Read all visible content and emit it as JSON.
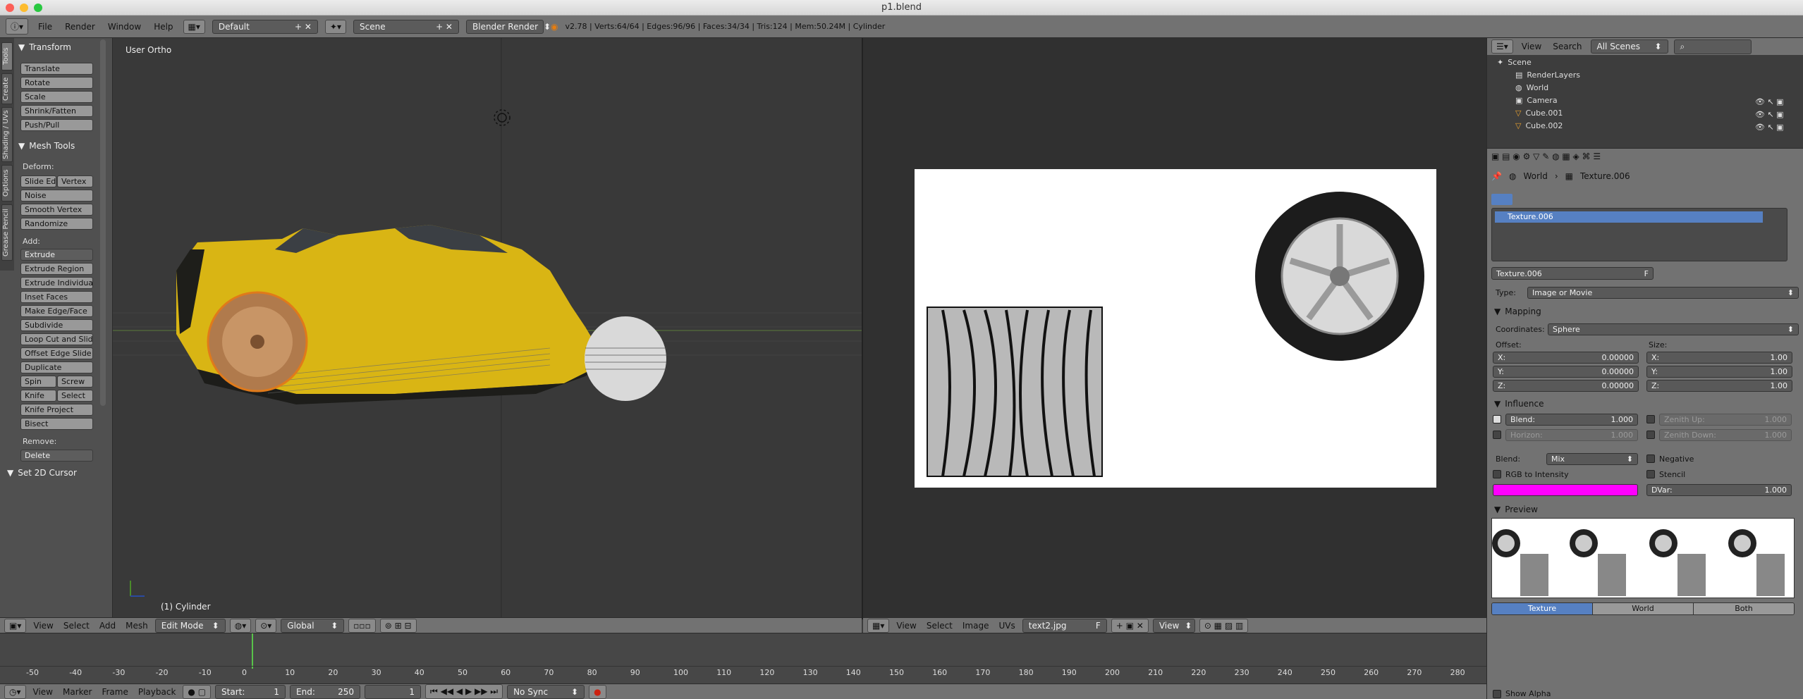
{
  "window": {
    "title": "p1.blend"
  },
  "infobar": {
    "menus": [
      "File",
      "Render",
      "Window",
      "Help"
    ],
    "layout": "Default",
    "scene": "Scene",
    "engine": "Blender Render",
    "stats": "v2.78 | Verts:64/64 | Edges:96/96 | Faces:34/34 | Tris:124 | Mem:50.24M | Cylinder"
  },
  "toolshelf": {
    "tabs": [
      "Tools",
      "Create",
      "Shading / UVs",
      "Options",
      "Grease Pencil"
    ],
    "transform_title": "Transform",
    "transform": [
      "Translate",
      "Rotate",
      "Scale",
      "Shrink/Fatten",
      "Push/Pull"
    ],
    "mesh_title": "Mesh Tools",
    "deform_label": "Deform:",
    "slide_edge": "Slide Ed",
    "vertex": "Vertex",
    "noise": "Noise",
    "smooth_vertex": "Smooth Vertex",
    "randomize": "Randomize",
    "add_label": "Add:",
    "extrude": "Extrude",
    "add_items": [
      "Extrude Region",
      "Extrude Individual",
      "Inset Faces",
      "Make Edge/Face",
      "Subdivide",
      "Loop Cut and Slide",
      "Offset Edge Slide",
      "Duplicate"
    ],
    "spin": "Spin",
    "screw": "Screw",
    "knife": "Knife",
    "select": "Select",
    "knife_project": "Knife Project",
    "bisect": "Bisect",
    "remove_label": "Remove:",
    "delete": "Delete",
    "cursor_title": "Set 2D Cursor"
  },
  "viewport": {
    "view_name": "User Ortho",
    "object_name": "(1) Cylinder"
  },
  "header3d": {
    "menus": [
      "View",
      "Select",
      "Add",
      "Mesh"
    ],
    "mode": "Edit Mode",
    "orientation": "Global"
  },
  "imgheader": {
    "menus": [
      "View",
      "Select",
      "Image",
      "UVs"
    ],
    "image": "text2.jpg",
    "view": "View",
    "f": "F"
  },
  "timeline": {
    "ticks": [
      "-50",
      "-40",
      "-30",
      "-20",
      "-10",
      "0",
      "10",
      "20",
      "30",
      "40",
      "50",
      "60",
      "70",
      "80",
      "90",
      "100",
      "110",
      "120",
      "130",
      "140",
      "150",
      "160",
      "170",
      "180",
      "190",
      "200",
      "210",
      "220",
      "230",
      "240",
      "250",
      "260",
      "270",
      "280"
    ],
    "current_frame": 1,
    "header_menus": [
      "View",
      "Marker",
      "Frame",
      "Playback"
    ],
    "start_label": "Start:",
    "start": "1",
    "end_label": "End:",
    "end": "250",
    "frame": "1",
    "sync": "No Sync"
  },
  "outliner": {
    "menus": [
      "View",
      "Search"
    ],
    "filter": "All Scenes",
    "items": [
      "Scene",
      "RenderLayers",
      "World",
      "Camera",
      "Cube.001",
      "Cube.002"
    ]
  },
  "properties": {
    "breadcrumb": [
      "World",
      "Texture.006"
    ],
    "slot": "Texture.006",
    "texture_name": "Texture.006",
    "f": "F",
    "type_label": "Type:",
    "type": "Image or Movie",
    "mapping_title": "Mapping",
    "coordinates_label": "Coordinates:",
    "coordinates": "Sphere",
    "offset_label": "Offset:",
    "size_label": "Size:",
    "offset": [
      {
        "axis": "X:",
        "value": "0.00000"
      },
      {
        "axis": "Y:",
        "value": "0.00000"
      },
      {
        "axis": "Z:",
        "value": "0.00000"
      }
    ],
    "size": [
      {
        "axis": "X:",
        "value": "1.00"
      },
      {
        "axis": "Y:",
        "value": "1.00"
      },
      {
        "axis": "Z:",
        "value": "1.00"
      }
    ],
    "influence_title": "Influence",
    "blend_infl_label": "Blend:",
    "blend_infl_value": "1.000",
    "horizon_label": "Horizon:",
    "horizon_value": "1.000",
    "zenith_up_label": "Zenith Up:",
    "zenith_up_value": "1.000",
    "zenith_down_label": "Zenith Down:",
    "zenith_down_value": "1.000",
    "blend_label": "Blend:",
    "blend_mode": "Mix",
    "negative": "Negative",
    "rgb_to_intensity": "RGB to Intensity",
    "stencil": "Stencil",
    "dvar_label": "DVar:",
    "dvar_value": "1.000",
    "preview_title": "Preview",
    "preview_tabs": [
      "Texture",
      "World",
      "Both"
    ],
    "show_alpha": "Show Alpha",
    "color": "#ff00ff"
  }
}
